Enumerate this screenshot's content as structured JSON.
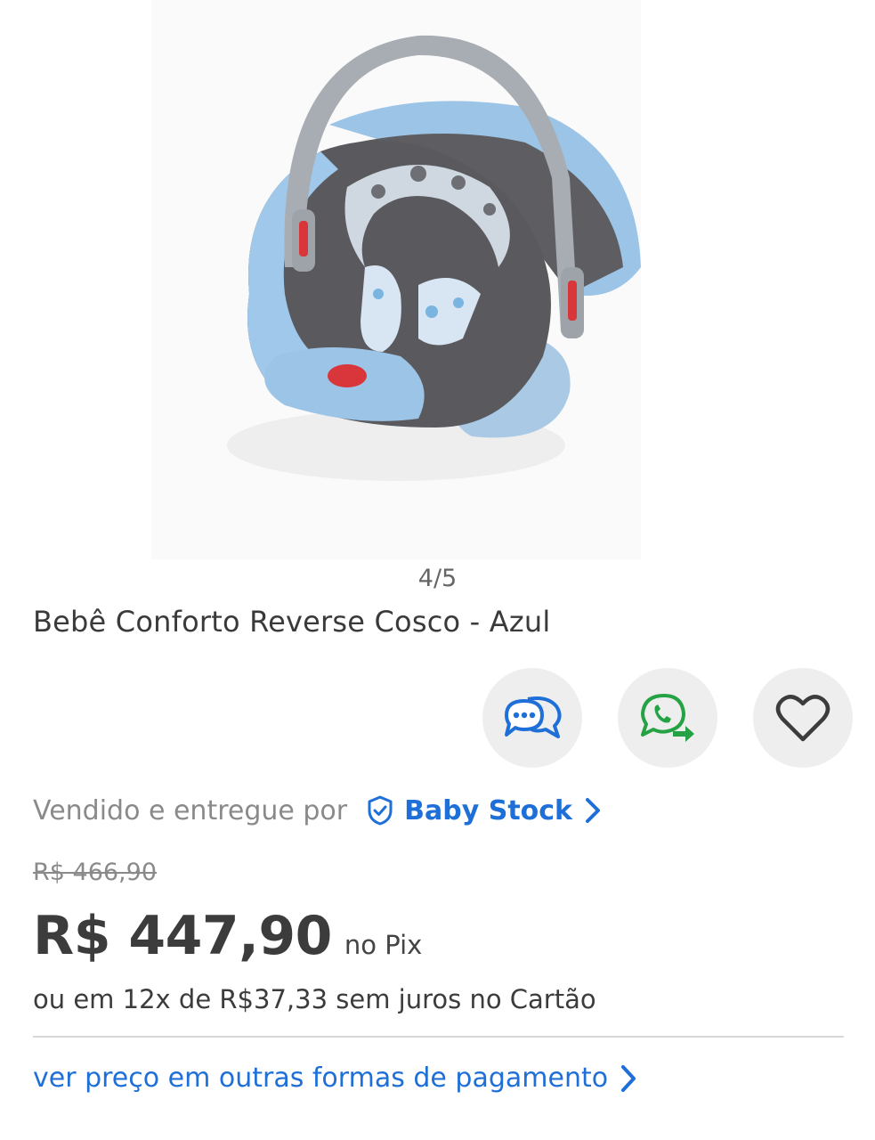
{
  "gallery": {
    "current": "4",
    "total": "5",
    "counter_text": "4/5"
  },
  "product": {
    "title": "Bebê Conforto Reverse Cosco - Azul"
  },
  "actions": {
    "chat_icon": "chat-bubbles-icon",
    "whatsapp_icon": "whatsapp-share-icon",
    "favorite_icon": "heart-icon"
  },
  "seller": {
    "prefix": "Vendido e entregue por",
    "name": "Baby Stock",
    "badge_icon": "verified-shield-icon"
  },
  "pricing": {
    "old_price": "R$ 466,90",
    "price": "R$ 447,90",
    "price_suffix": "no Pix",
    "installments": "ou em 12x de R$37,33 sem juros no Cartão"
  },
  "payment_link": {
    "label": "ver preço em outras formas de pagamento"
  },
  "colors": {
    "link_blue": "#1f6fd8",
    "whatsapp_green": "#25a244",
    "button_bg": "#eeeeee",
    "text_dark": "#3c3c3c",
    "text_muted": "#8a8a8a"
  }
}
